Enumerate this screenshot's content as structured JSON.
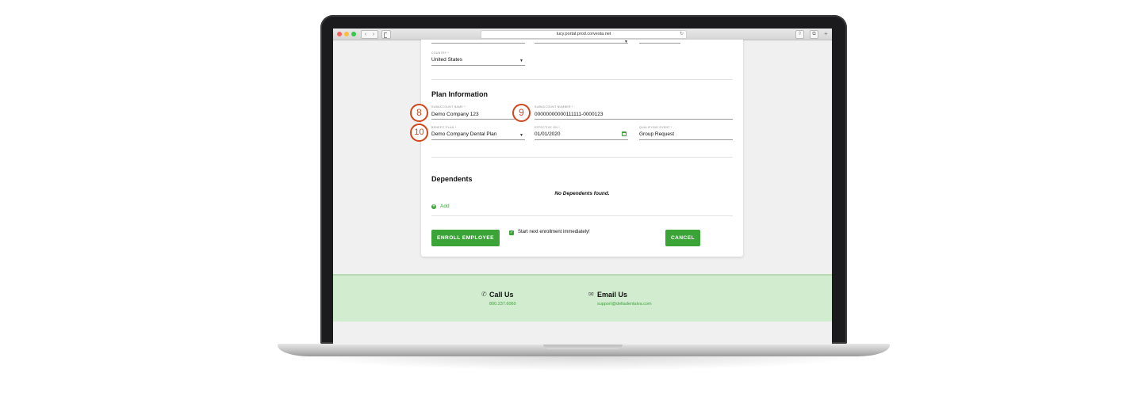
{
  "browser": {
    "url": "lucy.portal.prod.corvesta.net",
    "nav_back": "‹",
    "nav_forward": "›",
    "reload_icon": "↻",
    "share_icon": "⇧",
    "tabs_icon": "⧉",
    "plus_icon": "+"
  },
  "form": {
    "country": {
      "label": "Country *",
      "value": "United States"
    },
    "plan_section": {
      "title": "Plan Information",
      "subaccount_name": {
        "label": "Subaccount Name *",
        "value": "Demo Company 123"
      },
      "subaccount_number": {
        "label": "Subaccount Number *",
        "value": "00000000000111111-0000123"
      },
      "benefit_plan": {
        "label": "Benefit Plan *",
        "value": "Demo Company Dental Plan"
      },
      "effective_on": {
        "label": "Effective On *",
        "value": "01/01/2020"
      },
      "qualifying_event": {
        "label": "Qualifying Event *",
        "value": "Group Request"
      }
    },
    "dependents_section": {
      "title": "Dependents",
      "empty_text": "No Dependents found.",
      "add_label": "Add",
      "add_icon": "+"
    },
    "enroll_button": "ENROLL EMPLOYEE",
    "checkbox_label": "Start next enrollment immediately!",
    "checkbox_mark": "✓",
    "cancel_button": "CANCEL",
    "caret": "▼"
  },
  "markers": {
    "m8": "8",
    "m9": "9",
    "m10": "10"
  },
  "footer": {
    "call": {
      "title": "Call Us",
      "value": "800.237.6060",
      "icon": "✆"
    },
    "email": {
      "title": "Email Us",
      "value": "support@deltadentalva.com",
      "icon": "✉"
    }
  },
  "colors": {
    "accent": "#3aa437",
    "marker": "#d2461c",
    "footer_bg": "#d2eccf"
  }
}
